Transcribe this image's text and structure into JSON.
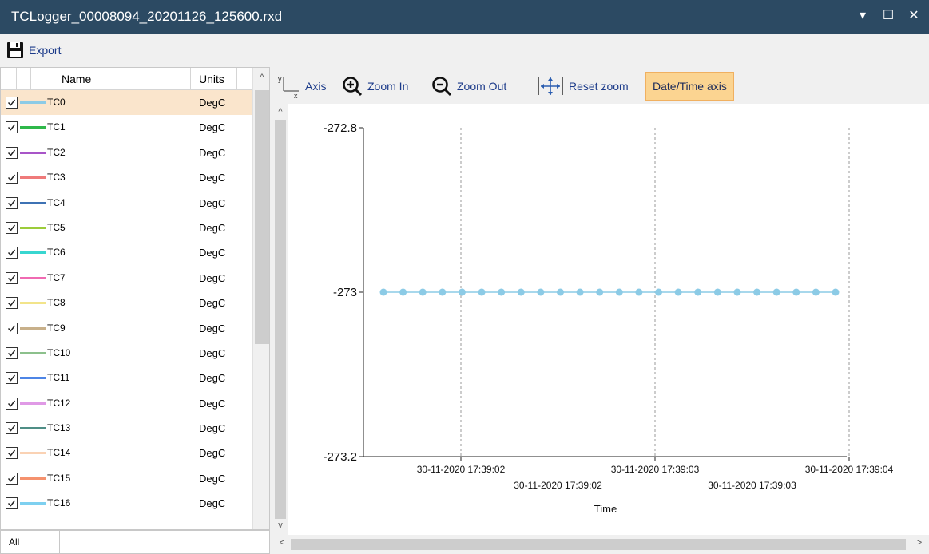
{
  "window": {
    "title": "TCLogger_00008094_20201126_125600.rxd",
    "controls": {
      "menu": "▾",
      "maximize": "☐",
      "close": "✕"
    }
  },
  "toolbar": {
    "export_label": "Export"
  },
  "channel_list": {
    "columns": {
      "name": "Name",
      "units": "Units"
    },
    "rows": [
      {
        "name": "TC0",
        "units": "DegC",
        "color": "#8ccbe6",
        "checked": true,
        "selected": true
      },
      {
        "name": "TC1",
        "units": "DegC",
        "color": "#2fb84a",
        "checked": true
      },
      {
        "name": "TC2",
        "units": "DegC",
        "color": "#a855c8",
        "checked": true
      },
      {
        "name": "TC3",
        "units": "DegC",
        "color": "#ef7a7a",
        "checked": true
      },
      {
        "name": "TC4",
        "units": "DegC",
        "color": "#3e72b4",
        "checked": true
      },
      {
        "name": "TC5",
        "units": "DegC",
        "color": "#9ccc3a",
        "checked": true
      },
      {
        "name": "TC6",
        "units": "DegC",
        "color": "#38d6d0",
        "checked": true
      },
      {
        "name": "TC7",
        "units": "DegC",
        "color": "#f06ab2",
        "checked": true
      },
      {
        "name": "TC8",
        "units": "DegC",
        "color": "#f2e48a",
        "checked": true
      },
      {
        "name": "TC9",
        "units": "DegC",
        "color": "#c8b08a",
        "checked": true
      },
      {
        "name": "TC10",
        "units": "DegC",
        "color": "#8cc08c",
        "checked": true
      },
      {
        "name": "TC11",
        "units": "DegC",
        "color": "#4d85e6",
        "checked": true
      },
      {
        "name": "TC12",
        "units": "DegC",
        "color": "#e09ae6",
        "checked": true
      },
      {
        "name": "TC13",
        "units": "DegC",
        "color": "#4f8e86",
        "checked": true
      },
      {
        "name": "TC14",
        "units": "DegC",
        "color": "#fad2b4",
        "checked": true
      },
      {
        "name": "TC15",
        "units": "DegC",
        "color": "#f5926e",
        "checked": true
      },
      {
        "name": "TC16",
        "units": "DegC",
        "color": "#7ed0f0",
        "checked": true
      }
    ],
    "filter_label": "All"
  },
  "chart_toolbar": {
    "axis_label": "Axis",
    "zoom_in_label": "Zoom In",
    "zoom_out_label": "Zoom Out",
    "reset_zoom_label": "Reset zoom",
    "datetime_axis_label": "Date/Time axis",
    "datetime_axis_active": true
  },
  "chart_data": {
    "type": "line",
    "xlabel": "Time",
    "ylabel": "",
    "ylim": [
      -273.2,
      -272.8
    ],
    "y_ticks": [
      "-272.8",
      "-273",
      "-273.2"
    ],
    "x_ticks": [
      {
        "label": "30-11-2020 17:39:02",
        "row": 1
      },
      {
        "label": "30-11-2020 17:39:02",
        "row": 2
      },
      {
        "label": "30-11-2020 17:39:03",
        "row": 1
      },
      {
        "label": "30-11-2020 17:39:03",
        "row": 2
      },
      {
        "label": "30-11-2020 17:39:04",
        "row": 1
      }
    ],
    "series": [
      {
        "color": "#8ccbe6",
        "point_color": "#8ccbe6",
        "values": [
          -273,
          -273,
          -273,
          -273,
          -273,
          -273,
          -273,
          -273,
          -273,
          -273,
          -273,
          -273,
          -273,
          -273,
          -273,
          -273,
          -273,
          -273,
          -273,
          -273,
          -273,
          -273,
          -273,
          -273
        ]
      }
    ],
    "grid": "vertical-dashed"
  }
}
